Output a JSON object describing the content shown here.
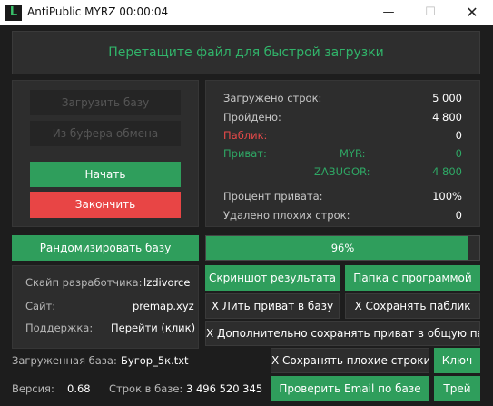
{
  "window": {
    "title": "AntiPublic MYRZ 00:00:04",
    "app_icon_glyph": "L",
    "minimize_glyph": "—",
    "maximize_glyph": "☐",
    "close_glyph": "✕"
  },
  "drop_zone": {
    "text": "Перетащите файл для быстрой загрузки"
  },
  "left_panel": {
    "load_db_label": "Загрузить базу",
    "from_clipboard_label": "Из буфера обмена",
    "start_label": "Начать",
    "stop_label": "Закончить"
  },
  "stats": {
    "loaded_lines_label": "Загружено строк:",
    "loaded_lines_value": "5 000",
    "passed_label": "Пройдено:",
    "passed_value": "4 800",
    "public_label": "Паблик:",
    "public_value": "0",
    "private_label": "Приват:",
    "myr_label": "MYR:",
    "myr_value": "0",
    "zabugor_label": "ZABUGOR:",
    "zabugor_value": "4 800",
    "private_percent_label": "Процент привата:",
    "private_percent_value": "100%",
    "bad_removed_label": "Удалено плохих строк:",
    "bad_removed_value": "0"
  },
  "randomize_label": "Рандомизировать базу",
  "progress": {
    "percent": 96,
    "text": "96%"
  },
  "info": {
    "dev_skype_label": "Скайп разработчика:",
    "dev_skype_value": "lzdivorce",
    "site_label": "Сайт:",
    "site_value": "premap.xyz",
    "support_label": "Поддержка:",
    "support_value": "Перейти (клик)"
  },
  "actions": {
    "screenshot_label": "Скриншот результата",
    "program_folder_label": "Папка с программой",
    "pour_private_label": "X Лить приват в базу",
    "save_public_label": "X Сохранять паблик",
    "save_private_common_label": "X Дополнительно сохранять приват в общую папку",
    "save_bad_lines_label": "X Сохранять плохие строки",
    "key_label": "Ключ",
    "check_email_label": "Проверить Email по базе",
    "tray_label": "Трей"
  },
  "bottom": {
    "loaded_db_label": "Загруженная база:",
    "loaded_db_value": "Бугор_5к.txt",
    "version_label": "Версия:",
    "version_value": "0.68",
    "lines_in_db_label": "Строк в базе:",
    "lines_in_db_value": "3 496 520 345"
  },
  "colors": {
    "accent_green": "#2f9e5c",
    "danger_red": "#e84545",
    "panel_bg": "#2d2d2d",
    "window_bg": "#1d1d1d"
  }
}
